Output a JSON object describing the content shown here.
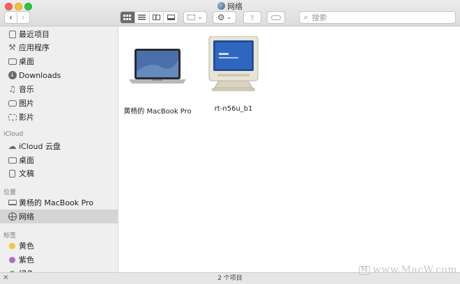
{
  "window": {
    "title": "网络"
  },
  "toolbar": {
    "back_label": "‹",
    "forward_label": "›",
    "action_glyph": "⚙",
    "chevron": "⌄",
    "share_glyph": "⇪",
    "search_placeholder": "搜索"
  },
  "sidebar": {
    "favorites": [
      {
        "label": "最近项目",
        "icon": "clock-icon"
      },
      {
        "label": "应用程序",
        "icon": "apps-icon"
      },
      {
        "label": "桌面",
        "icon": "desktop-icon"
      },
      {
        "label": "Downloads",
        "icon": "download-icon"
      },
      {
        "label": "音乐",
        "icon": "music-icon"
      },
      {
        "label": "图片",
        "icon": "camera-icon"
      },
      {
        "label": "影片",
        "icon": "film-icon"
      }
    ],
    "icloud_header": "iCloud",
    "icloud": [
      {
        "label": "iCloud 云盘",
        "icon": "cloud-icon"
      },
      {
        "label": "桌面",
        "icon": "desktop-icon"
      },
      {
        "label": "文稿",
        "icon": "document-icon"
      }
    ],
    "locations_header": "位置",
    "locations": [
      {
        "label": "黄杨的 MacBook Pro",
        "icon": "laptop-icon"
      },
      {
        "label": "网络",
        "icon": "globe-icon",
        "selected": true
      }
    ],
    "tags_header": "标签",
    "tags": [
      {
        "label": "黄色",
        "color": "#f5c53f"
      },
      {
        "label": "紫色",
        "color": "#b36ad0"
      },
      {
        "label": "绿色",
        "color": "#4cc04c"
      }
    ]
  },
  "content": {
    "items": [
      {
        "label": "黄杨的 MacBook Pro",
        "icon": "macbook-icon"
      },
      {
        "label": "rt-n56u_b1",
        "icon": "crt-monitor-icon"
      }
    ]
  },
  "status": {
    "text": "2 个项目",
    "close_glyph": "✕"
  },
  "watermark": {
    "logo": "M",
    "text": "www.MacW.com"
  }
}
